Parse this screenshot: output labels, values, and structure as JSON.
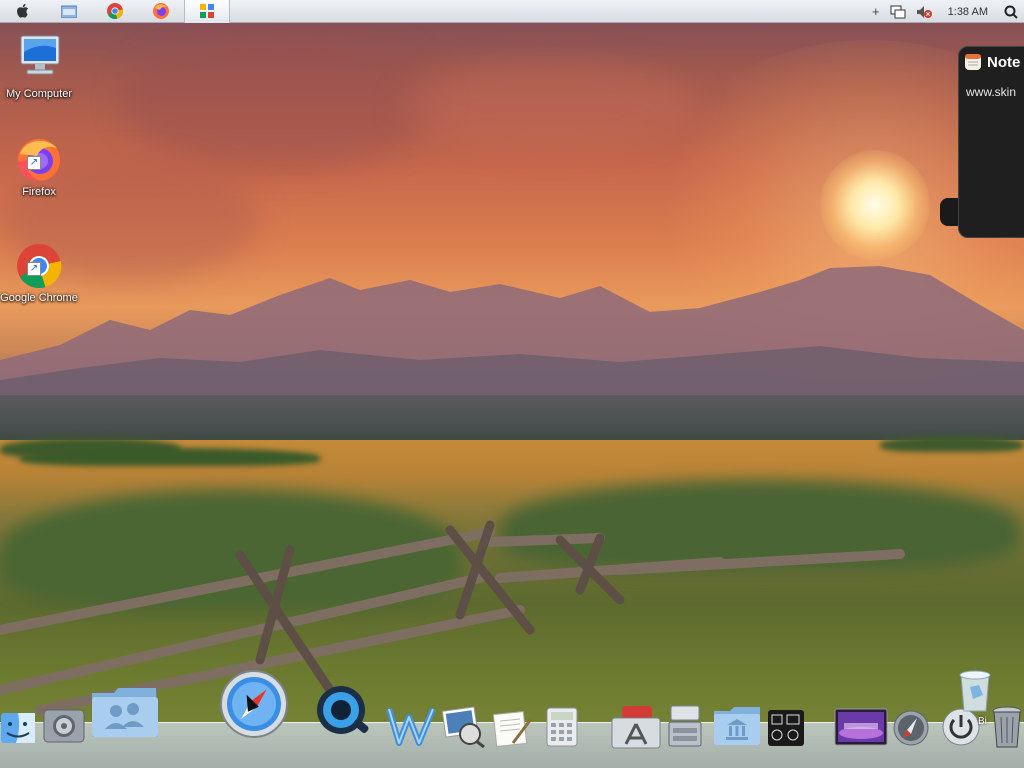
{
  "menubar": {
    "tabs": [
      {
        "name": "apple-icon",
        "active": false
      },
      {
        "name": "folder-icon",
        "active": false
      },
      {
        "name": "chrome-icon",
        "active": false
      },
      {
        "name": "firefox-icon",
        "active": false
      },
      {
        "name": "app-icon",
        "active": true
      }
    ],
    "tray": {
      "plus": "+",
      "clock": "1:38 AM"
    }
  },
  "desktop": {
    "icons": [
      {
        "label": "My Computer",
        "icon": "computer-icon"
      },
      {
        "label": "Firefox",
        "icon": "firefox-icon"
      },
      {
        "label": "Google Chrome",
        "icon": "chrome-icon"
      }
    ]
  },
  "notes_widget": {
    "title": "Note",
    "body": "www.skin"
  },
  "dock": {
    "items": [
      "finder-icon",
      "system-preferences-icon",
      "users-folder-icon",
      "safari-icon",
      "quicktime-icon",
      "word-icon",
      "iphoto-icon",
      "textedit-icon",
      "calculator-icon",
      "app-store-icon",
      "disk-utility-icon",
      "library-folder-icon",
      "dashboard-icon",
      "front-row-icon",
      "launchpad-icon",
      "power-icon",
      "trash-icon",
      "recycle-bin-icon"
    ],
    "trash_label": "Bi"
  },
  "colors": {
    "menubar_bg": "#e4e8ed",
    "notes_bg": "#1f1f1f"
  }
}
